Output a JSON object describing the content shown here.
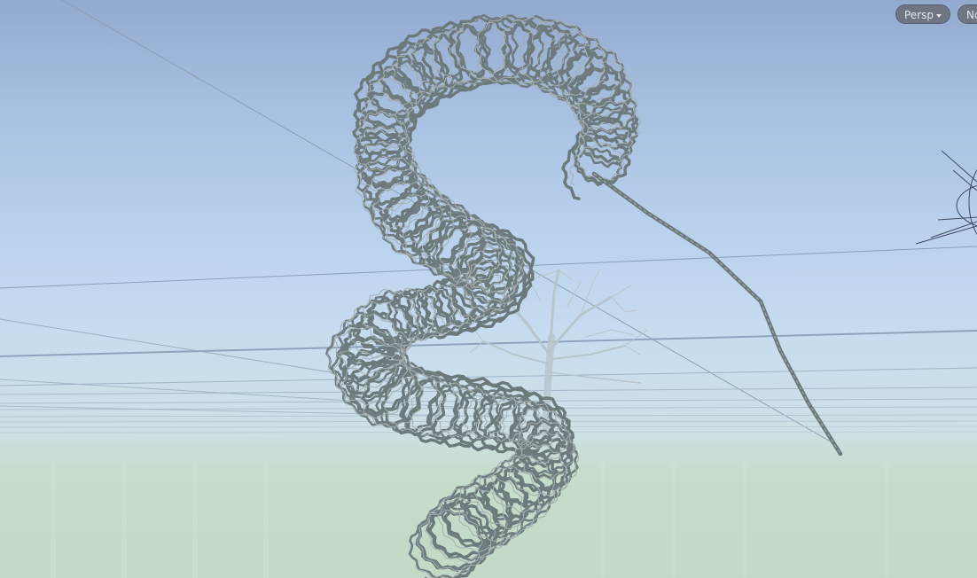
{
  "viewport": {
    "projection_label": "Persp",
    "second_button_label": "No",
    "projection_dropdown_icon": "chevron-down-icon",
    "colors": {
      "sky_top": "#93aacf",
      "horizon": "#cfe0e6",
      "ground": "#c3d9c6",
      "wire": "#6d7a7c",
      "tree": "#b9c7cc",
      "grid": "#8fa3bb"
    }
  }
}
